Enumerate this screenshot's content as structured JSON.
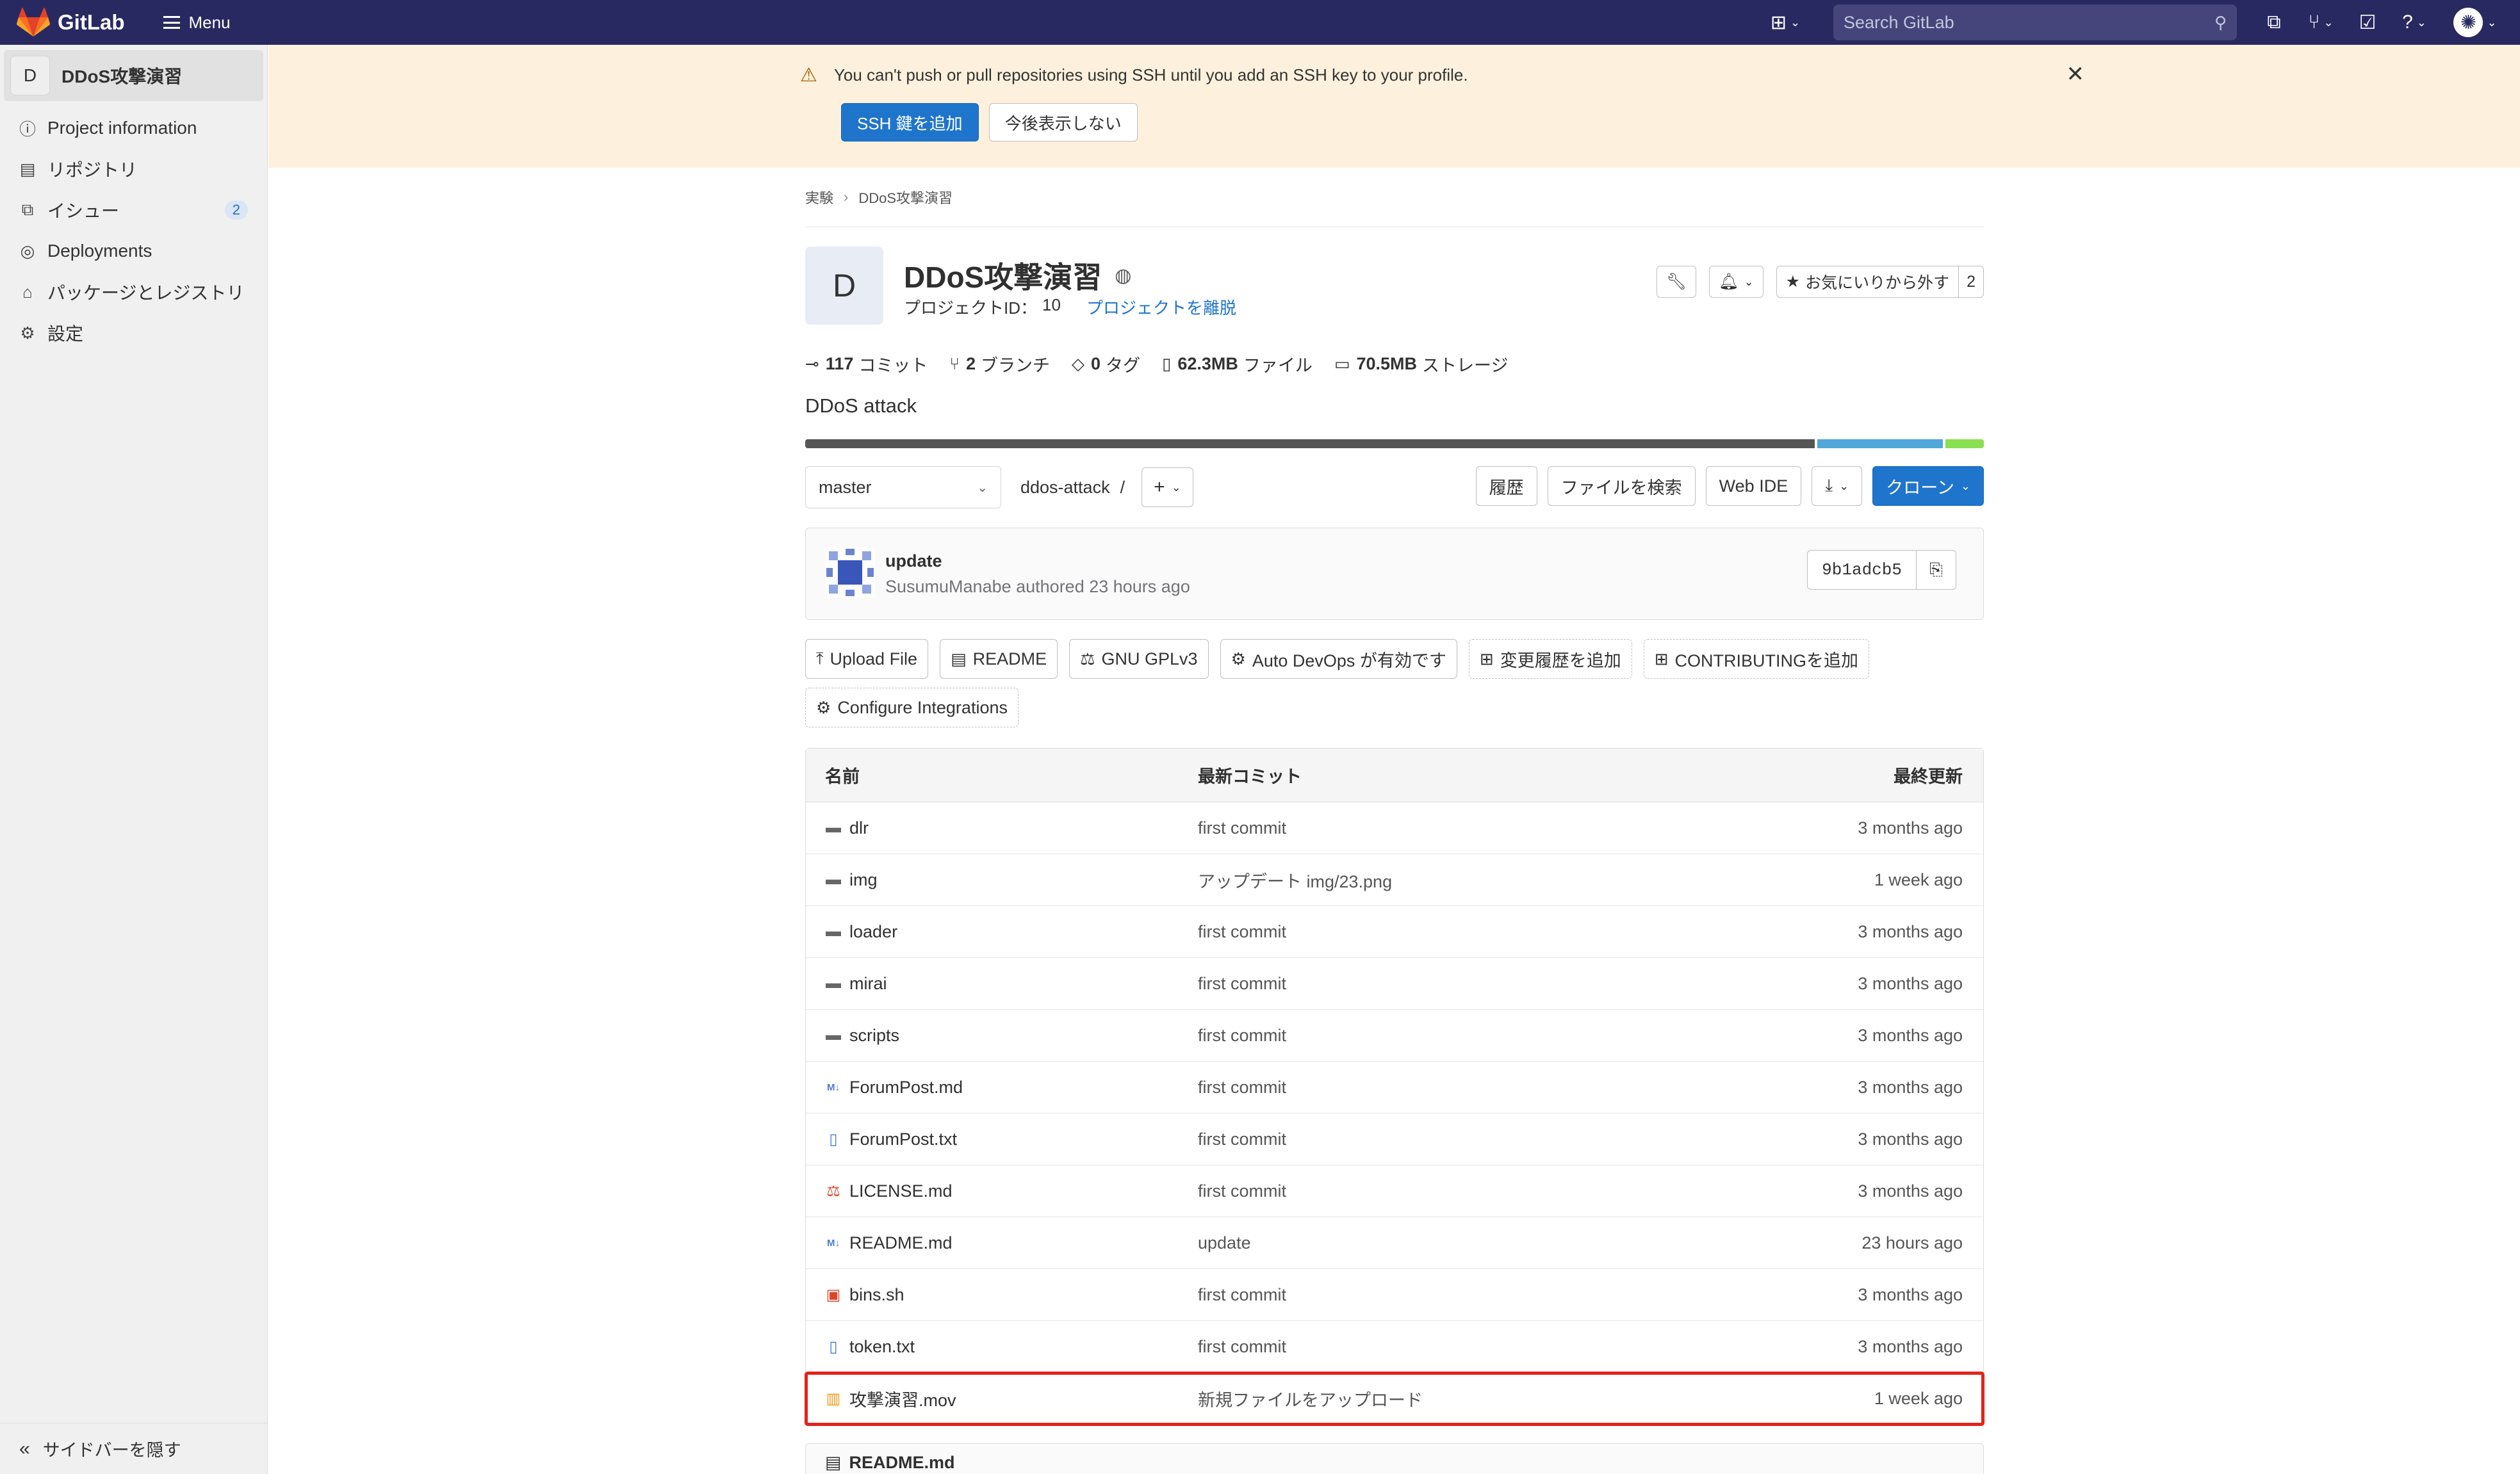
{
  "topbar": {
    "brand": "GitLab",
    "menu_label": "Menu",
    "search_placeholder": "Search GitLab",
    "icons": [
      "plus-square-icon",
      "issues-icon",
      "merge-request-icon",
      "todo-icon",
      "help-icon",
      "user-avatar"
    ]
  },
  "sidebar": {
    "project_letter": "D",
    "project_name": "DDoS攻撃演習",
    "items": [
      {
        "label": "Project information",
        "icon": "info-icon"
      },
      {
        "label": "リポジトリ",
        "icon": "document-icon"
      },
      {
        "label": "イシュー",
        "icon": "issues-icon",
        "count": "2"
      },
      {
        "label": "Deployments",
        "icon": "rocket-icon"
      },
      {
        "label": "パッケージとレジストリ",
        "icon": "package-icon"
      },
      {
        "label": "設定",
        "icon": "gear-icon"
      }
    ],
    "collapse_label": "サイドバーを隠す"
  },
  "alert": {
    "message": "You can't push or pull repositories using SSH until you add an SSH key to your profile.",
    "primary_btn": "SSH 鍵を追加",
    "secondary_btn": "今後表示しない"
  },
  "breadcrumb": [
    "実験",
    "DDoS攻撃演習"
  ],
  "project": {
    "letter": "D",
    "title": "DDoS攻撃演習",
    "id_label": "プロジェクトID：",
    "id_value": "10",
    "leave_link": "プロジェクトを離脱",
    "star_label": "お気にいりから外す",
    "star_count": "2",
    "description": "DDoS attack"
  },
  "stats": [
    {
      "value": "117",
      "label": "コミット",
      "icon": "commit-icon"
    },
    {
      "value": "2",
      "label": "ブランチ",
      "icon": "branch-icon"
    },
    {
      "value": "0",
      "label": "タグ",
      "icon": "tag-icon"
    },
    {
      "value": "62.3MB",
      "label": "ファイル",
      "icon": "file-icon"
    },
    {
      "value": "70.5MB",
      "label": "ストレージ",
      "icon": "storage-icon"
    }
  ],
  "languages": [
    {
      "share": 0.86,
      "color": "#555555"
    },
    {
      "share": 0.107,
      "color": "#4fa8d8"
    },
    {
      "share": 0.033,
      "color": "#89e051"
    }
  ],
  "toolbar": {
    "branch": "master",
    "path": "ddos-attack",
    "path_sep": "/",
    "history": "履歴",
    "find_file": "ファイルを検索",
    "web_ide": "Web IDE",
    "clone": "クローン"
  },
  "last_commit": {
    "title": "update",
    "author_line": "SusumuManabe authored 23 hours ago",
    "sha": "9b1adcb5"
  },
  "quick_actions": [
    {
      "label": "Upload File",
      "icon": "upload-icon",
      "dashed": false
    },
    {
      "label": "README",
      "icon": "document-icon",
      "dashed": false
    },
    {
      "label": "GNU GPLv3",
      "icon": "scale-icon",
      "dashed": false
    },
    {
      "label": "Auto DevOps が有効です",
      "icon": "gear-icon",
      "dashed": false
    },
    {
      "label": "変更履歴を追加",
      "icon": "plus-square-icon",
      "dashed": true
    },
    {
      "label": "CONTRIBUTINGを追加",
      "icon": "plus-square-icon",
      "dashed": true
    },
    {
      "label": "Configure Integrations",
      "icon": "gear-icon",
      "dashed": true
    }
  ],
  "file_table": {
    "headers": {
      "name": "名前",
      "commit": "最新コミット",
      "updated": "最終更新"
    },
    "rows": [
      {
        "name": "dlr",
        "type": "folder",
        "commit": "first commit",
        "updated": "3 months ago"
      },
      {
        "name": "img",
        "type": "folder",
        "commit": "アップデート img/23.png",
        "updated": "1 week ago"
      },
      {
        "name": "loader",
        "type": "folder",
        "commit": "first commit",
        "updated": "3 months ago"
      },
      {
        "name": "mirai",
        "type": "folder",
        "commit": "first commit",
        "updated": "3 months ago"
      },
      {
        "name": "scripts",
        "type": "folder",
        "commit": "first commit",
        "updated": "3 months ago"
      },
      {
        "name": "ForumPost.md",
        "type": "markdown",
        "commit": "first commit",
        "updated": "3 months ago"
      },
      {
        "name": "ForumPost.txt",
        "type": "text",
        "commit": "first commit",
        "updated": "3 months ago"
      },
      {
        "name": "LICENSE.md",
        "type": "license",
        "commit": "first commit",
        "updated": "3 months ago"
      },
      {
        "name": "README.md",
        "type": "markdown",
        "commit": "update",
        "updated": "23 hours ago"
      },
      {
        "name": "bins.sh",
        "type": "shell",
        "commit": "first commit",
        "updated": "3 months ago"
      },
      {
        "name": "token.txt",
        "type": "text",
        "commit": "first commit",
        "updated": "3 months ago"
      },
      {
        "name": "攻撃演習.mov",
        "type": "video",
        "commit": "新規ファイルをアップロード",
        "updated": "1 week ago",
        "highlighted": true
      }
    ]
  },
  "readme_header": "README.md",
  "colors": {
    "topbar": "#292961",
    "primary": "#1f75cb",
    "alert_bg": "#fdf1dd",
    "highlight": "#e2231a"
  }
}
